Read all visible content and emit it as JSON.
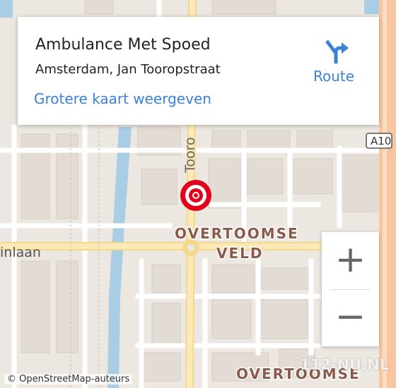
{
  "card": {
    "title": "Ambulance Met Spoed",
    "address": "Amsterdam, Jan Tooropstraat",
    "map_link": "Grotere kaart weergeven",
    "route_label": "Route",
    "route_icon": "route-turn-right-icon"
  },
  "map": {
    "street_tooro": "Tooro",
    "street_inlaan": "inlaan",
    "district_label_1": "OVERTOOMSE",
    "district_label_2": "VELD",
    "district_label_3": "OVERTOOMSE",
    "highway_shield": "A10",
    "marker_icon": "location-target-icon",
    "colors": {
      "road_major": "#f8e4a8",
      "road_minor": "#ffffff",
      "water": "#a9cde4",
      "land": "#ece7e1",
      "building": "#e0dad3",
      "marker": "#e2001a",
      "link": "#3b82d6"
    }
  },
  "zoom": {
    "in_label": "+",
    "out_label": "−"
  },
  "attribution": "© OpenStreetMap-auteurs",
  "watermark": "112-NU.NL"
}
